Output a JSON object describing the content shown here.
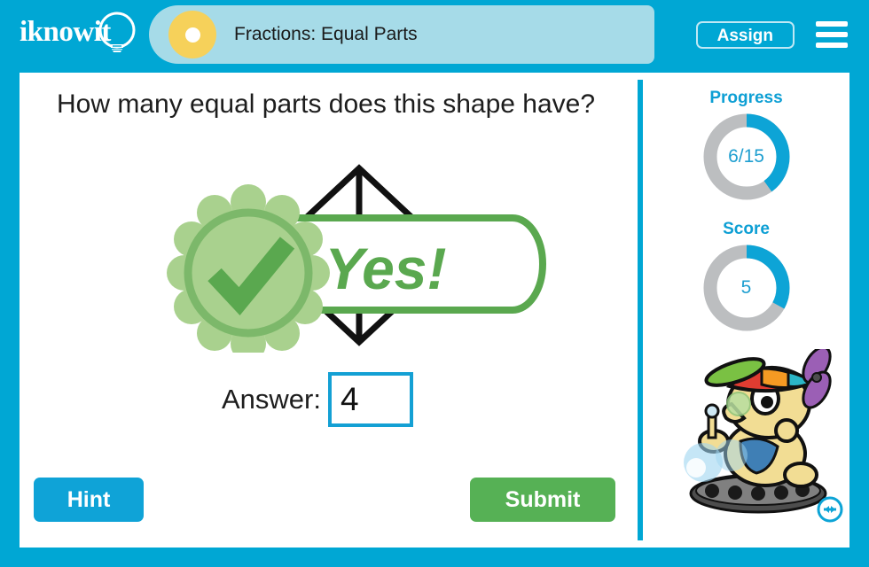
{
  "app": {
    "brand": "iknowit",
    "brand_icon": "lightbulb-icon",
    "frame_color": "#00a7d4"
  },
  "header": {
    "title": "Fractions: Equal Parts",
    "title_pill_color": "#a6dbe8",
    "title_dot_color": "#f6d15a",
    "assign_label": "Assign",
    "menu_icon": "hamburger-menu-icon"
  },
  "question": {
    "text": "How many equal parts does this shape have?"
  },
  "figure": {
    "shape_name": "rhombus-divided-into-parts",
    "shape_stroke": "#111111",
    "parts": 4
  },
  "feedback": {
    "text": "Yes!",
    "icon": "check-circle-icon",
    "color": "#56a84f",
    "badge_fill": "#a9d18e",
    "banner_border": "#56a84f"
  },
  "answer": {
    "label": "Answer:",
    "value": "4",
    "placeholder": "",
    "border_color": "#14a0d4"
  },
  "buttons": {
    "hint": "Hint",
    "hint_color": "#0fa3d7",
    "submit": "Submit",
    "submit_color": "#56b155"
  },
  "sidebar": {
    "progress": {
      "label": "Progress",
      "value": "6/15",
      "percent": 40,
      "arc_color": "#0da4d6",
      "track_color": "#bcbec0"
    },
    "score": {
      "label": "Score",
      "value": "5",
      "percent": 33,
      "arc_color": "#0da4d6",
      "track_color": "#bcbec0"
    },
    "mascot_icon": "robot-mascot-icon",
    "resize_icon": "resize-horizontal-icon"
  }
}
